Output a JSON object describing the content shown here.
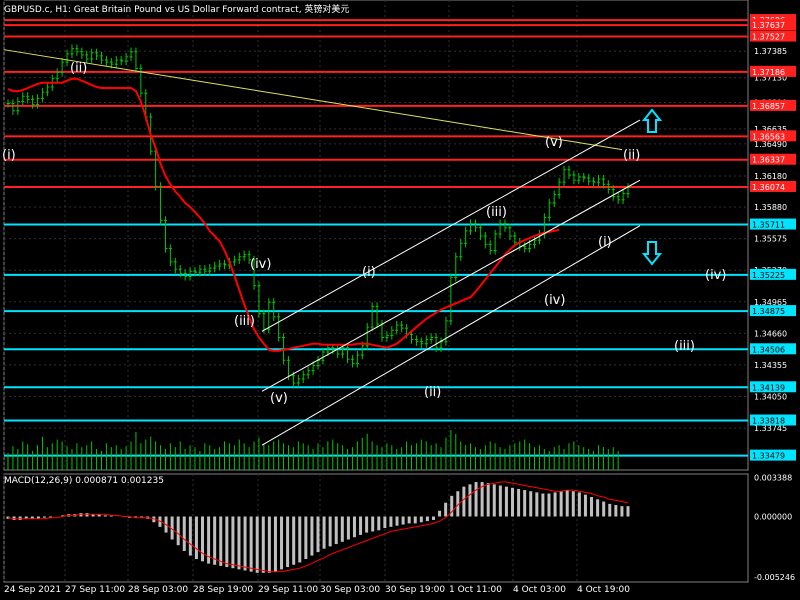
{
  "header": {
    "title": "GBPUSD.c, H1:  Great Britain Pound vs US Dollar Forward contract, 英镑对美元"
  },
  "colors": {
    "background": "#000000",
    "grid": "#2f2f2f",
    "candle": "#00c800",
    "ma_line": "#ff0000",
    "trendline": "#e0e060",
    "resistance": "#ff2020",
    "support": "#00e5ff",
    "wave_label": "#ffffff",
    "macd_hist": "#c0c0c0",
    "macd_signal": "#ff0000",
    "arrow": "#00e5ff"
  },
  "chart_data": [
    {
      "type": "candlestick",
      "name": "price",
      "title": "GBPUSD.c, H1:  Great Britain Pound vs US Dollar Forward contract, 英镑对美元",
      "x_ticks": [
        "24 Sep 2021",
        "27 Sep 11:00",
        "28 Sep 03:00",
        "28 Sep 19:00",
        "29 Sep 11:00",
        "30 Sep 03:00",
        "30 Sep 19:00",
        "1 Oct 11:00",
        "4 Oct 03:00",
        "4 Oct 19:00"
      ],
      "y_ticks": [
        "1.37640",
        "1.37385",
        "1.37130",
        "1.36890",
        "1.36635",
        "1.36490",
        "1.36180",
        "1.35880",
        "1.35575",
        "1.35270",
        "1.34965",
        "1.34660",
        "1.34355",
        "1.34050",
        "1.33745"
      ],
      "ylim": [
        1.3334,
        1.3788
      ],
      "close": [
        1.3688,
        1.3681,
        1.369,
        1.3695,
        1.3692,
        1.3687,
        1.3693,
        1.3699,
        1.3704,
        1.3712,
        1.3718,
        1.3728,
        1.3736,
        1.3741,
        1.3738,
        1.3735,
        1.3731,
        1.3737,
        1.3734,
        1.373,
        1.3728,
        1.3726,
        1.373,
        1.3729,
        1.3733,
        1.3738,
        1.3722,
        1.3698,
        1.3675,
        1.3642,
        1.3608,
        1.3575,
        1.3548,
        1.3535,
        1.3528,
        1.3524,
        1.3521,
        1.3526,
        1.3525,
        1.3528,
        1.3526,
        1.3529,
        1.3531,
        1.3533,
        1.3532,
        1.3535,
        1.3537,
        1.354,
        1.3542,
        1.3537,
        1.3512,
        1.3485,
        1.347,
        1.3496,
        1.3482,
        1.3462,
        1.344,
        1.3425,
        1.3418,
        1.3422,
        1.3426,
        1.343,
        1.3435,
        1.344,
        1.3448,
        1.3452,
        1.345,
        1.3446,
        1.3452,
        1.3441,
        1.3437,
        1.3445,
        1.3454,
        1.3472,
        1.3492,
        1.3475,
        1.3462,
        1.3464,
        1.3469,
        1.3474,
        1.3471,
        1.3465,
        1.346,
        1.3458,
        1.3456,
        1.346,
        1.3462,
        1.3452,
        1.3458,
        1.3478,
        1.352,
        1.354,
        1.3553,
        1.3565,
        1.3572,
        1.3568,
        1.356,
        1.3552,
        1.3546,
        1.3562,
        1.3572,
        1.3568,
        1.356,
        1.3554,
        1.355,
        1.3548,
        1.3552,
        1.3556,
        1.3562,
        1.3578,
        1.3592,
        1.36,
        1.3612,
        1.3624,
        1.3619,
        1.3614,
        1.3617,
        1.3616,
        1.3613,
        1.3612,
        1.3615,
        1.361,
        1.3605,
        1.3598,
        1.3595,
        1.3601,
        1.3607
      ],
      "ma": [
        1.3702,
        1.37,
        1.37,
        1.3701,
        1.3703,
        1.3705,
        1.3707,
        1.3708,
        1.3708,
        1.3708,
        1.3708,
        1.3708,
        1.371,
        1.3712,
        1.3712,
        1.371,
        1.3708,
        1.3706,
        1.3704,
        1.3703,
        1.3703,
        1.3703,
        1.3703,
        1.3703,
        1.3703,
        1.3703,
        1.37,
        1.369,
        1.3675,
        1.3658,
        1.3645,
        1.363,
        1.3618,
        1.361,
        1.3603,
        1.3598,
        1.3592,
        1.3588,
        1.3583,
        1.3578,
        1.3572,
        1.3565,
        1.356,
        1.3555,
        1.3546,
        1.3535,
        1.3522,
        1.3508,
        1.3494,
        1.3482,
        1.347,
        1.3462,
        1.3456,
        1.345,
        1.3449,
        1.3449,
        1.345,
        1.3451,
        1.3452,
        1.3453,
        1.3454,
        1.3455,
        1.3456,
        1.3456,
        1.3455,
        1.3455,
        1.3455,
        1.3455,
        1.3455,
        1.3455,
        1.3455,
        1.3456,
        1.3456,
        1.3456,
        1.3455,
        1.3454,
        1.3453,
        1.3452,
        1.3454,
        1.3456,
        1.346,
        1.3464,
        1.3468,
        1.3472,
        1.3476,
        1.348,
        1.3483,
        1.3486,
        1.3489,
        1.3491,
        1.3493,
        1.3495,
        1.3497,
        1.3499,
        1.3501,
        1.3506,
        1.3512,
        1.3518,
        1.3524,
        1.353,
        1.3536,
        1.3542,
        1.3547,
        1.3551,
        1.3554,
        1.3556,
        1.3558,
        1.356,
        1.3562,
        1.3563,
        1.3564,
        1.3565,
        1.3566
      ],
      "volume": [
        18,
        25,
        22,
        30,
        27,
        20,
        26,
        35,
        24,
        28,
        32,
        30,
        25,
        22,
        28,
        24,
        26,
        30,
        22,
        20,
        28,
        24,
        26,
        22,
        25,
        30,
        40,
        28,
        32,
        35,
        30,
        26,
        22,
        28,
        24,
        30,
        22,
        26,
        24,
        20,
        28,
        26,
        22,
        24,
        30,
        28,
        26,
        32,
        28,
        24,
        30,
        34,
        28,
        26,
        30,
        32,
        28,
        26,
        24,
        30,
        28,
        26,
        22,
        28,
        24,
        30,
        32,
        28,
        26,
        22,
        24,
        30,
        34,
        38,
        30,
        26,
        24,
        28,
        26,
        22,
        24,
        30,
        26,
        28,
        32,
        30,
        26,
        28,
        24,
        34,
        42,
        38,
        30,
        26,
        28,
        24,
        22,
        26,
        30,
        28,
        24,
        22,
        26,
        28,
        30,
        32,
        28,
        24,
        26,
        22,
        20,
        24,
        26,
        22,
        28,
        30,
        26,
        24,
        22,
        20,
        26,
        24,
        22,
        24,
        20
      ],
      "resistance_levels": [
        1.37686,
        1.37637,
        1.37527,
        1.37186,
        1.36857,
        1.36563,
        1.36337,
        1.36074
      ],
      "resistance_labels": [
        "1.37686",
        "1.37637",
        "1.37527",
        "1.37186",
        "1.36857",
        "1.36563",
        "1.36337",
        "1.36074"
      ],
      "support_levels": [
        1.35711,
        1.35225,
        1.34875,
        1.34506,
        1.34139,
        1.33818,
        1.33479
      ],
      "support_labels": [
        "1.35711",
        "1.35225",
        "1.34875",
        "1.34506",
        "1.34139",
        "1.33818",
        "1.33479"
      ],
      "wave_labels": [
        "(i)",
        "(ii)",
        "(iii)",
        "(iv)",
        "(v)",
        "(i)",
        "(ii)",
        "(iii)",
        "(iv)",
        "(v)",
        "(ii)",
        "(i)",
        "(iv)",
        "(iv)",
        "(iii)"
      ]
    },
    {
      "type": "bar",
      "name": "macd",
      "title": "MACD(12,26,9) 0.000871 0.001235",
      "y_ticks": [
        "0.003388",
        "0.000000",
        "-0.005246"
      ],
      "ylim": [
        -0.0057,
        0.0037
      ],
      "histogram": [
        -0.0002,
        -0.0003,
        -0.0003,
        -0.0002,
        -0.0002,
        -0.0002,
        -0.0001,
        -0.0001,
        0.0,
        0.0001,
        0.0002,
        0.0002,
        0.0003,
        0.0003,
        0.0002,
        0.0002,
        0.0001,
        0.0001,
        0.0,
        0.0,
        -0.0001,
        -0.0001,
        -0.0001,
        -0.0002,
        -0.0005,
        -0.0009,
        -0.0014,
        -0.002,
        -0.0025,
        -0.003,
        -0.0034,
        -0.0037,
        -0.0039,
        -0.0041,
        -0.0042,
        -0.0043,
        -0.0044,
        -0.0045,
        -0.0046,
        -0.0047,
        -0.0048,
        -0.0049,
        -0.0049,
        -0.0049,
        -0.0048,
        -0.0046,
        -0.0044,
        -0.0042,
        -0.004,
        -0.0037,
        -0.0034,
        -0.0031,
        -0.0028,
        -0.0026,
        -0.0024,
        -0.0022,
        -0.002,
        -0.0018,
        -0.0016,
        -0.0014,
        -0.0013,
        -0.0012,
        -0.001,
        -0.0009,
        -0.0008,
        -0.0007,
        -0.0006,
        -0.0006,
        -0.0005,
        -0.0004,
        -0.0003,
        0.0005,
        0.0012,
        0.0018,
        0.0022,
        0.0026,
        0.0028,
        0.003,
        0.003,
        0.0029,
        0.0028,
        0.0027,
        0.0026,
        0.0025,
        0.0024,
        0.0023,
        0.0022,
        0.0021,
        0.002,
        0.002,
        0.0021,
        0.0022,
        0.0023,
        0.0022,
        0.0021,
        0.0019,
        0.0017,
        0.0015,
        0.0013,
        0.0011,
        0.001,
        0.0009,
        0.0009
      ],
      "signal": [
        -0.0001,
        -0.0002,
        -0.0002,
        -0.0002,
        -0.0002,
        -0.0002,
        -0.0002,
        -0.0001,
        -0.0001,
        0.0,
        0.0001,
        0.0001,
        0.0002,
        0.0002,
        0.0002,
        0.0002,
        0.0002,
        0.0001,
        0.0001,
        0.0,
        0.0,
        -0.0001,
        -0.0001,
        -0.0001,
        -0.0002,
        -0.0004,
        -0.0007,
        -0.0011,
        -0.0015,
        -0.002,
        -0.0024,
        -0.0028,
        -0.0032,
        -0.0035,
        -0.0037,
        -0.0039,
        -0.0041,
        -0.0042,
        -0.0043,
        -0.0044,
        -0.0045,
        -0.0046,
        -0.0047,
        -0.0048,
        -0.0048,
        -0.0048,
        -0.0047,
        -0.0046,
        -0.0045,
        -0.0043,
        -0.0041,
        -0.0038,
        -0.0036,
        -0.0033,
        -0.0031,
        -0.0029,
        -0.0027,
        -0.0025,
        -0.0023,
        -0.0021,
        -0.0019,
        -0.0017,
        -0.0015,
        -0.0013,
        -0.0012,
        -0.0011,
        -0.001,
        -0.0009,
        -0.0008,
        -0.0007,
        -0.0006,
        -0.0004,
        -0.0001,
        0.0004,
        0.001,
        0.0015,
        0.0019,
        0.0023,
        0.0026,
        0.0028,
        0.0029,
        0.003,
        0.003,
        0.0029,
        0.0028,
        0.0027,
        0.0026,
        0.0025,
        0.0024,
        0.0023,
        0.0022,
        0.0022,
        0.0023,
        0.0023,
        0.0022,
        0.0021,
        0.002,
        0.0018,
        0.0017,
        0.0015,
        0.0014,
        0.0013,
        0.0012
      ]
    }
  ]
}
